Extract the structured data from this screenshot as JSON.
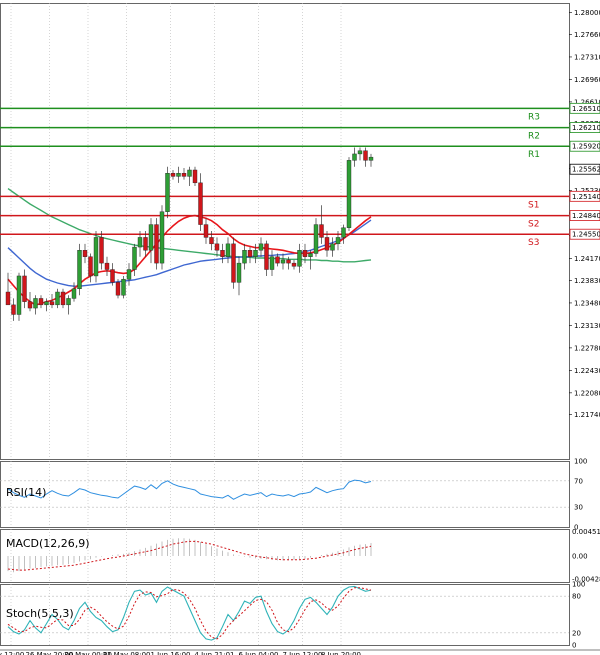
{
  "colors": {
    "bull": "#2e9e35",
    "bear": "#d0161b",
    "support": "#d0161b",
    "resistance": "#1e8f1e",
    "ma_red": "#e8161b",
    "ma_blue": "#3f67d1",
    "ma_green": "#3daa68",
    "rsi": "#2f8fe0",
    "macd_hist": "#c0c0c0",
    "macd_signal": "#d0161b",
    "stoch_main": "#2fb3b8",
    "stoch_signal": "#d0161b",
    "grid": "#b9b9b9"
  },
  "chart_data": [
    {
      "type": "candlestick",
      "ylim": [
        1.2105,
        1.2815
      ],
      "yticks": [
        "1.28000",
        "1.27660",
        "1.27310",
        "1.26960",
        "1.26610",
        "1.26270",
        "1.25920",
        "1.25570",
        "1.25230",
        "1.24880",
        "1.24530",
        "1.24170",
        "1.23830",
        "1.23480",
        "1.23130",
        "1.22780",
        "1.22430",
        "1.22080",
        "1.21740"
      ],
      "x_labels": [
        "y 12:00",
        "26 May 20:00",
        "30 May 00:00",
        "31 May 08:00",
        "1 Jun 16:00",
        "4 Jun 21:01",
        "6 Jun 04:00",
        "7 Jun 12:00",
        "8 Jun 20:00"
      ],
      "current_price": "1.25562",
      "levels": [
        {
          "name": "R3",
          "value": 1.2651,
          "label": "1.26510",
          "kind": "resistance"
        },
        {
          "name": "R2",
          "value": 1.2621,
          "label": "1.26210",
          "kind": "resistance"
        },
        {
          "name": "R1",
          "value": 1.2592,
          "label": "1.25920",
          "kind": "resistance"
        },
        {
          "name": "S1",
          "value": 1.2514,
          "label": "1.25140",
          "kind": "support"
        },
        {
          "name": "S2",
          "value": 1.2484,
          "label": "1.24840",
          "kind": "support"
        },
        {
          "name": "S3",
          "value": 1.2455,
          "label": "1.24550",
          "kind": "support"
        }
      ],
      "candles": [
        [
          1.2365,
          1.2395,
          1.2345,
          1.2345
        ],
        [
          1.2345,
          1.2355,
          1.232,
          1.233
        ],
        [
          1.233,
          1.2395,
          1.232,
          1.239
        ],
        [
          1.239,
          1.24,
          1.234,
          1.235
        ],
        [
          1.235,
          1.2365,
          1.2335,
          1.234
        ],
        [
          1.234,
          1.236,
          1.233,
          1.2355
        ],
        [
          1.2355,
          1.236,
          1.234,
          1.2345
        ],
        [
          1.2345,
          1.2355,
          1.2335,
          1.235
        ],
        [
          1.235,
          1.2362,
          1.234,
          1.2345
        ],
        [
          1.2345,
          1.237,
          1.234,
          1.2365
        ],
        [
          1.2365,
          1.237,
          1.234,
          1.2345
        ],
        [
          1.2345,
          1.236,
          1.233,
          1.2355
        ],
        [
          1.2355,
          1.238,
          1.235,
          1.237
        ],
        [
          1.237,
          1.244,
          1.236,
          1.243
        ],
        [
          1.243,
          1.244,
          1.241,
          1.242
        ],
        [
          1.242,
          1.2425,
          1.238,
          1.239
        ],
        [
          1.239,
          1.246,
          1.238,
          1.245
        ],
        [
          1.245,
          1.246,
          1.24,
          1.241
        ],
        [
          1.241,
          1.242,
          1.239,
          1.24
        ],
        [
          1.24,
          1.241,
          1.2375,
          1.238
        ],
        [
          1.238,
          1.2385,
          1.2355,
          1.236
        ],
        [
          1.236,
          1.239,
          1.2355,
          1.2385
        ],
        [
          1.2385,
          1.241,
          1.2375,
          1.24
        ],
        [
          1.24,
          1.244,
          1.239,
          1.2435
        ],
        [
          1.2435,
          1.246,
          1.242,
          1.245
        ],
        [
          1.245,
          1.246,
          1.242,
          1.243
        ],
        [
          1.243,
          1.248,
          1.241,
          1.247
        ],
        [
          1.247,
          1.248,
          1.24,
          1.241
        ],
        [
          1.241,
          1.25,
          1.24,
          1.249
        ],
        [
          1.249,
          1.256,
          1.248,
          1.255
        ],
        [
          1.255,
          1.2555,
          1.254,
          1.2545
        ],
        [
          1.2545,
          1.256,
          1.2535,
          1.255
        ],
        [
          1.255,
          1.2558,
          1.254,
          1.2545
        ],
        [
          1.2545,
          1.256,
          1.253,
          1.2555
        ],
        [
          1.2555,
          1.256,
          1.253,
          1.2535
        ],
        [
          1.2535,
          1.255,
          1.246,
          1.247
        ],
        [
          1.247,
          1.248,
          1.244,
          1.245
        ],
        [
          1.245,
          1.246,
          1.243,
          1.244
        ],
        [
          1.244,
          1.245,
          1.242,
          1.243
        ],
        [
          1.243,
          1.244,
          1.241,
          1.242
        ],
        [
          1.242,
          1.245,
          1.241,
          1.244
        ],
        [
          1.244,
          1.245,
          1.237,
          1.238
        ],
        [
          1.238,
          1.242,
          1.236,
          1.241
        ],
        [
          1.241,
          1.244,
          1.24,
          1.243
        ],
        [
          1.243,
          1.2435,
          1.241,
          1.242
        ],
        [
          1.242,
          1.244,
          1.241,
          1.243
        ],
        [
          1.243,
          1.245,
          1.242,
          1.244
        ],
        [
          1.244,
          1.2445,
          1.239,
          1.24
        ],
        [
          1.24,
          1.243,
          1.239,
          1.242
        ],
        [
          1.242,
          1.2425,
          1.2405,
          1.241
        ],
        [
          1.241,
          1.2425,
          1.24,
          1.2415
        ],
        [
          1.2415,
          1.242,
          1.24,
          1.241
        ],
        [
          1.241,
          1.2415,
          1.24,
          1.2405
        ],
        [
          1.2405,
          1.244,
          1.2395,
          1.243
        ],
        [
          1.243,
          1.244,
          1.241,
          1.242
        ],
        [
          1.242,
          1.243,
          1.24,
          1.2425
        ],
        [
          1.2425,
          1.248,
          1.242,
          1.247
        ],
        [
          1.247,
          1.25,
          1.244,
          1.245
        ],
        [
          1.245,
          1.246,
          1.242,
          1.243
        ],
        [
          1.243,
          1.245,
          1.242,
          1.244
        ],
        [
          1.244,
          1.246,
          1.243,
          1.245
        ],
        [
          1.245,
          1.247,
          1.244,
          1.2465
        ],
        [
          1.2465,
          1.2575,
          1.246,
          1.257
        ],
        [
          1.257,
          1.259,
          1.256,
          1.258
        ],
        [
          1.258,
          1.259,
          1.257,
          1.2585
        ],
        [
          1.2585,
          1.259,
          1.256,
          1.257
        ],
        [
          1.257,
          1.258,
          1.256,
          1.2575
        ]
      ],
      "ma_red": [
        1.2385,
        1.2375,
        1.2365,
        1.2357,
        1.235,
        1.2345,
        1.2347,
        1.235,
        1.2352,
        1.2356,
        1.236,
        1.2365,
        1.237,
        1.2378,
        1.2385,
        1.239,
        1.2395,
        1.2397,
        1.2398,
        1.2397,
        1.2395,
        1.2394,
        1.2395,
        1.24,
        1.241,
        1.242,
        1.243,
        1.244,
        1.245,
        1.246,
        1.2468,
        1.2475,
        1.248,
        1.2483,
        1.2484,
        1.2482,
        1.248,
        1.2476,
        1.247,
        1.2462,
        1.2456,
        1.2448,
        1.2442,
        1.2438,
        1.2436,
        1.2434,
        1.2434,
        1.2433,
        1.2432,
        1.2431,
        1.243,
        1.2428,
        1.2426,
        1.2425,
        1.2425,
        1.2426,
        1.2428,
        1.2431,
        1.2434,
        1.2438,
        1.2442,
        1.2448,
        1.2455,
        1.2462,
        1.2469,
        1.2476,
        1.2482
      ],
      "ma_blue": [
        1.2434,
        1.2426,
        1.2418,
        1.241,
        1.2402,
        1.2395,
        1.239,
        1.2385,
        1.2382,
        1.2379,
        1.2377,
        1.2375,
        1.2374,
        1.2374,
        1.2375,
        1.2376,
        1.2377,
        1.2378,
        1.2379,
        1.238,
        1.2381,
        1.2382,
        1.2383,
        1.2384,
        1.2386,
        1.2388,
        1.239,
        1.2392,
        1.2395,
        1.2398,
        1.2401,
        1.2404,
        1.2407,
        1.2409,
        1.2411,
        1.2413,
        1.2414,
        1.2415,
        1.2416,
        1.2417,
        1.2418,
        1.2419,
        1.2419,
        1.242,
        1.242,
        1.2421,
        1.2421,
        1.2422,
        1.2422,
        1.2423,
        1.2423,
        1.2424,
        1.2425,
        1.2426,
        1.2428,
        1.243,
        1.2433,
        1.2436,
        1.2439,
        1.2442,
        1.2445,
        1.2449,
        1.2454,
        1.2459,
        1.2465,
        1.2471,
        1.2477
      ],
      "ma_green": [
        1.2526,
        1.252,
        1.2514,
        1.2508,
        1.2502,
        1.2497,
        1.2492,
        1.2487,
        1.2482,
        1.2478,
        1.2474,
        1.247,
        1.2466,
        1.2462,
        1.2459,
        1.2456,
        1.2453,
        1.245,
        1.2448,
        1.2446,
        1.2444,
        1.2442,
        1.244,
        1.2438,
        1.2437,
        1.2436,
        1.2435,
        1.2434,
        1.2433,
        1.2432,
        1.2431,
        1.243,
        1.2429,
        1.2428,
        1.2427,
        1.2426,
        1.2425,
        1.2424,
        1.2423,
        1.2422,
        1.2421,
        1.242,
        1.242,
        1.2419,
        1.2419,
        1.2418,
        1.2418,
        1.2418,
        1.2417,
        1.2417,
        1.2417,
        1.2416,
        1.2416,
        1.2416,
        1.2415,
        1.2415,
        1.2415,
        1.2414,
        1.2414,
        1.2413,
        1.2413,
        1.2412,
        1.2412,
        1.2412,
        1.2413,
        1.2414,
        1.2415
      ]
    },
    {
      "type": "line",
      "name": "RSI(14)",
      "ylim": [
        0,
        100
      ],
      "yticks": [
        "100",
        "70",
        "30",
        "0"
      ],
      "values": [
        58,
        52,
        48,
        45,
        50,
        47,
        44,
        50,
        55,
        51,
        48,
        47,
        52,
        58,
        56,
        52,
        50,
        48,
        47,
        45,
        44,
        50,
        56,
        62,
        60,
        57,
        64,
        58,
        66,
        70,
        65,
        62,
        60,
        58,
        56,
        50,
        48,
        46,
        45,
        44,
        48,
        42,
        46,
        50,
        48,
        50,
        52,
        46,
        50,
        48,
        47,
        49,
        46,
        50,
        51,
        53,
        60,
        56,
        52,
        55,
        57,
        58,
        68,
        71,
        70,
        67,
        69
      ]
    },
    {
      "type": "bar",
      "name": "MACD(12,26,9)",
      "ylim": [
        -0.0048,
        0.005
      ],
      "yticks": [
        "0.004513",
        "0.00",
        "-0.004283"
      ],
      "values": [
        -0.0028,
        -0.003,
        -0.0028,
        -0.0025,
        -0.0023,
        -0.0022,
        -0.002,
        -0.0019,
        -0.0018,
        -0.0017,
        -0.0016,
        -0.0015,
        -0.0013,
        -0.001,
        -0.0008,
        -0.0006,
        -0.0003,
        -0.0001,
        0.0,
        0.0002,
        0.0003,
        0.0004,
        0.0006,
        0.0009,
        0.0012,
        0.0015,
        0.0019,
        0.0023,
        0.0027,
        0.003,
        0.0032,
        0.0033,
        0.0033,
        0.0032,
        0.003,
        0.0026,
        0.0022,
        0.0018,
        0.0014,
        0.001,
        0.0007,
        0.0003,
        0.0001,
        -0.0001,
        -0.0003,
        -0.0004,
        -0.0005,
        -0.0006,
        -0.0007,
        -0.0008,
        -0.0008,
        -0.0008,
        -0.0007,
        -0.0006,
        -0.0005,
        -0.0003,
        0.0,
        0.0002,
        0.0004,
        0.0006,
        0.0009,
        0.0012,
        0.0016,
        0.0019,
        0.0021,
        0.0022,
        0.0024
      ],
      "signal": [
        -0.0024,
        -0.0025,
        -0.0026,
        -0.0026,
        -0.0025,
        -0.0024,
        -0.0023,
        -0.0022,
        -0.0021,
        -0.002,
        -0.0019,
        -0.0018,
        -0.0017,
        -0.0015,
        -0.0013,
        -0.0011,
        -0.0009,
        -0.0007,
        -0.0005,
        -0.0003,
        -0.0002,
        0.0,
        0.0002,
        0.0004,
        0.0006,
        0.0008,
        0.001,
        0.0013,
        0.0016,
        0.0019,
        0.0022,
        0.0024,
        0.0026,
        0.0027,
        0.0027,
        0.0026,
        0.0024,
        0.0022,
        0.0019,
        0.0016,
        0.0013,
        0.001,
        0.0007,
        0.0004,
        0.0002,
        0.0,
        -0.0002,
        -0.0003,
        -0.0005,
        -0.0006,
        -0.0007,
        -0.0007,
        -0.0007,
        -0.0007,
        -0.0006,
        -0.0005,
        -0.0004,
        -0.0002,
        0.0,
        0.0002,
        0.0004,
        0.0006,
        0.0009,
        0.0012,
        0.0014,
        0.0016,
        0.0018
      ]
    },
    {
      "type": "line",
      "name": "Stoch(5,5,3)",
      "ylim": [
        0,
        100
      ],
      "yticks": [
        "100",
        "80",
        "20",
        "0"
      ],
      "main": [
        30,
        22,
        18,
        25,
        40,
        28,
        20,
        35,
        50,
        42,
        30,
        25,
        40,
        60,
        70,
        55,
        45,
        40,
        30,
        22,
        25,
        45,
        70,
        88,
        90,
        82,
        85,
        70,
        88,
        95,
        90,
        85,
        80,
        60,
        40,
        20,
        10,
        8,
        12,
        30,
        50,
        40,
        55,
        72,
        68,
        78,
        80,
        55,
        35,
        22,
        18,
        25,
        40,
        60,
        75,
        78,
        70,
        60,
        50,
        62,
        80,
        90,
        95,
        96,
        92,
        88,
        90
      ],
      "signal": [
        34,
        28,
        22,
        22,
        28,
        31,
        29,
        28,
        35,
        42,
        41,
        32,
        32,
        42,
        57,
        62,
        57,
        47,
        38,
        31,
        26,
        31,
        47,
        68,
        83,
        87,
        86,
        79,
        81,
        84,
        91,
        90,
        85,
        75,
        60,
        40,
        23,
        13,
        10,
        17,
        31,
        40,
        48,
        56,
        65,
        73,
        75,
        71,
        57,
        37,
        25,
        22,
        28,
        42,
        58,
        71,
        74,
        69,
        60,
        57,
        64,
        77,
        88,
        94,
        94,
        92,
        90
      ]
    }
  ],
  "labels": {
    "rsi": "RSI(14)",
    "macd": "MACD(12,26,9)",
    "stoch": "Stoch(5,5,3)"
  }
}
